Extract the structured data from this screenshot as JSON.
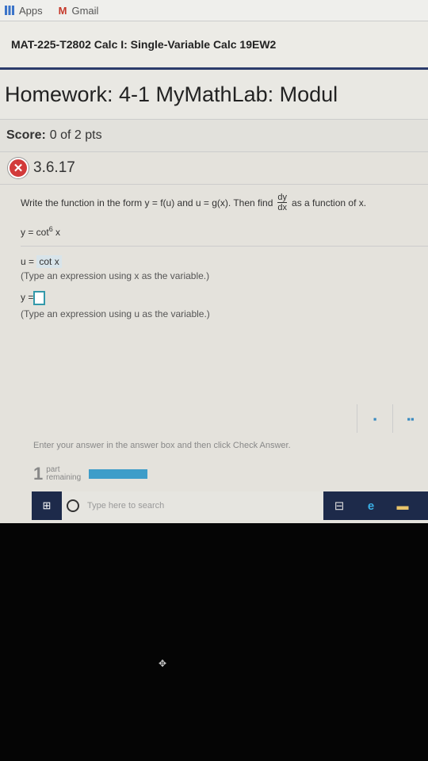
{
  "bookmarks": [
    {
      "label": "Apps",
      "icon": "apps-grid-icon"
    },
    {
      "label": "Gmail",
      "icon": "gmail-icon"
    }
  ],
  "course_title": "MAT-225-T2802 Calc I: Single-Variable Calc 19EW2",
  "homework_title": "Homework: 4-1 MyMathLab: Modul",
  "score": {
    "label": "Score:",
    "value": "0 of 2 pts"
  },
  "question": {
    "id": "3.6.17",
    "status": "incorrect"
  },
  "problem": {
    "instr_before": "Write the function in the form y = f(u) and u = g(x). Then find",
    "frac_num": "dy",
    "frac_den": "dx",
    "instr_after": "as a function of x.",
    "func_base": "y = cot",
    "func_exp": "6",
    "func_var": "x",
    "u_label": "u =",
    "u_value": "cot x",
    "u_hint": "(Type an expression using x as the variable.)",
    "y_label": "y =",
    "y_value": "",
    "y_hint": "(Type an expression using u as the variable.)"
  },
  "enter_text": "Enter your answer in the answer box and then click Check Answer.",
  "parts": {
    "count": "1",
    "label1": "part",
    "label2": "remaining",
    "progress": 1.0
  },
  "colors": {
    "accent": "#3e9dc9",
    "error": "#d23a3a",
    "taskbar": "#1d2a4a"
  },
  "taskbar": {
    "search_placeholder": "Type here to search"
  }
}
